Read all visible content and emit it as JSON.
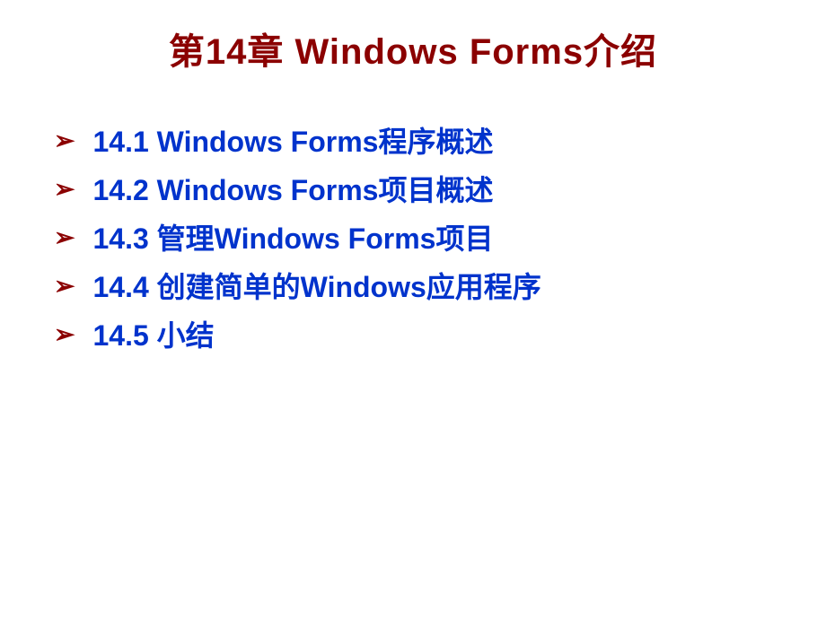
{
  "title": "第14章  Windows Forms介绍",
  "items": [
    {
      "text": "14.1  Windows Forms程序概述"
    },
    {
      "text": "14.2  Windows Forms项目概述"
    },
    {
      "text": "14.3  管理Windows Forms项目"
    },
    {
      "text": "14.4  创建简单的Windows应用程序"
    },
    {
      "text": "14.5  小结"
    }
  ],
  "bullet": "➢"
}
